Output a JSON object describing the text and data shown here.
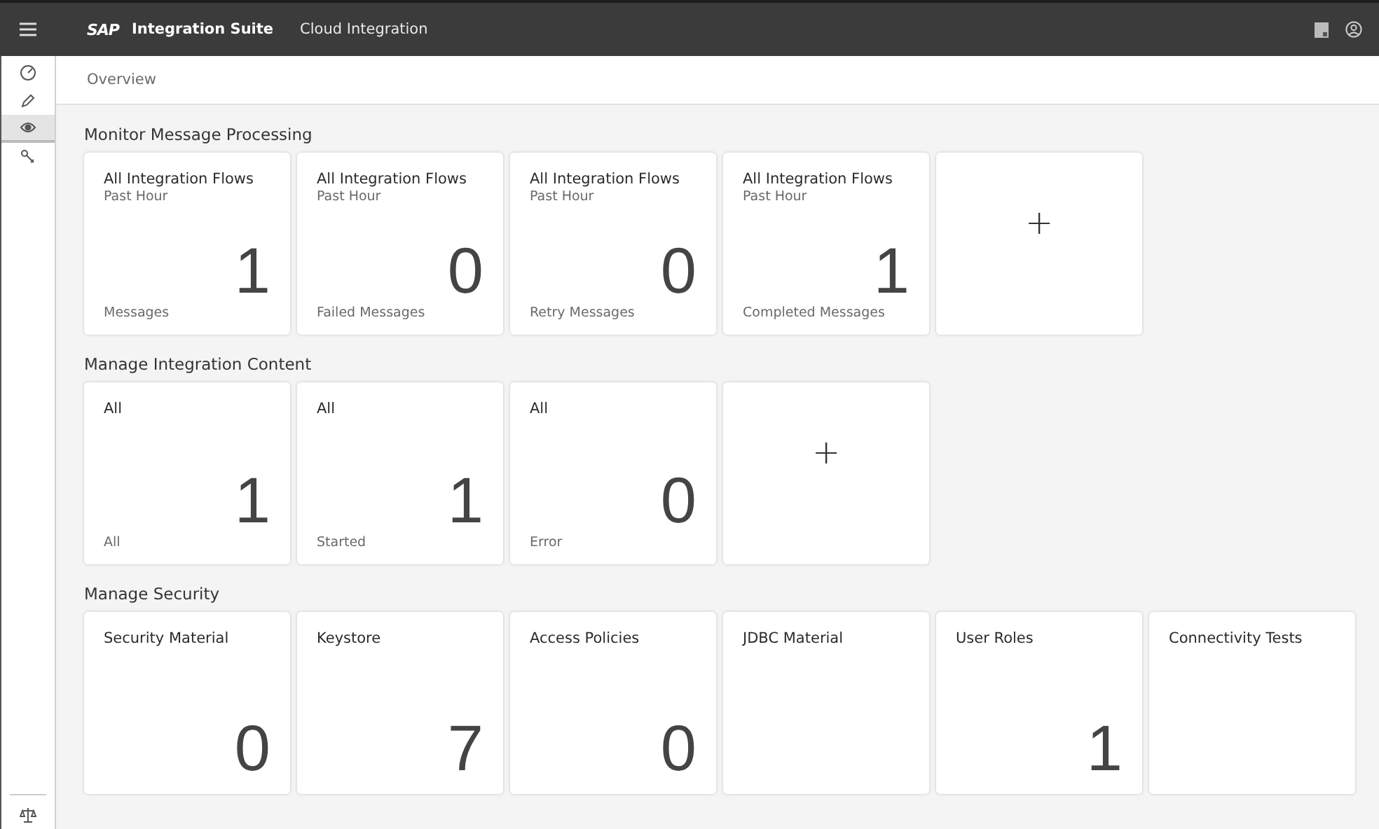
{
  "header": {
    "logo": "SAP",
    "product": "Integration Suite",
    "area": "Cloud Integration"
  },
  "nav": {
    "items": [
      {
        "selected": false
      },
      {
        "selected": false
      },
      {
        "selected": true
      },
      {
        "selected": false
      }
    ]
  },
  "breadcrumb": "Overview",
  "sections": [
    {
      "title": "Monitor Message Processing",
      "tiles": [
        {
          "kind": "kpi",
          "title": "All Integration Flows",
          "subtitle": "Past Hour",
          "value": "1",
          "footer": "Messages"
        },
        {
          "kind": "kpi",
          "title": "All Integration Flows",
          "subtitle": "Past Hour",
          "value": "0",
          "footer": "Failed Messages"
        },
        {
          "kind": "kpi",
          "title": "All Integration Flows",
          "subtitle": "Past Hour",
          "value": "0",
          "footer": "Retry Messages"
        },
        {
          "kind": "kpi",
          "title": "All Integration Flows",
          "subtitle": "Past Hour",
          "value": "1",
          "footer": "Completed Messages"
        },
        {
          "kind": "add",
          "symbol": "+"
        }
      ]
    },
    {
      "title": "Manage Integration Content",
      "tiles": [
        {
          "kind": "kpi",
          "title": "All",
          "value": "1",
          "footer": "All"
        },
        {
          "kind": "kpi",
          "title": "All",
          "value": "1",
          "footer": "Started"
        },
        {
          "kind": "kpi",
          "title": "All",
          "value": "0",
          "footer": "Error"
        },
        {
          "kind": "add",
          "symbol": "+"
        }
      ]
    },
    {
      "title": "Manage Security",
      "tiles": [
        {
          "kind": "kpi",
          "title": "Security Material",
          "value": "0"
        },
        {
          "kind": "kpi",
          "title": "Keystore",
          "value": "7"
        },
        {
          "kind": "kpi",
          "title": "Access Policies",
          "value": "0"
        },
        {
          "kind": "kpi",
          "title": "JDBC Material"
        },
        {
          "kind": "kpi",
          "title": "User Roles",
          "value": "1"
        },
        {
          "kind": "kpi",
          "title": "Connectivity Tests"
        }
      ]
    }
  ]
}
